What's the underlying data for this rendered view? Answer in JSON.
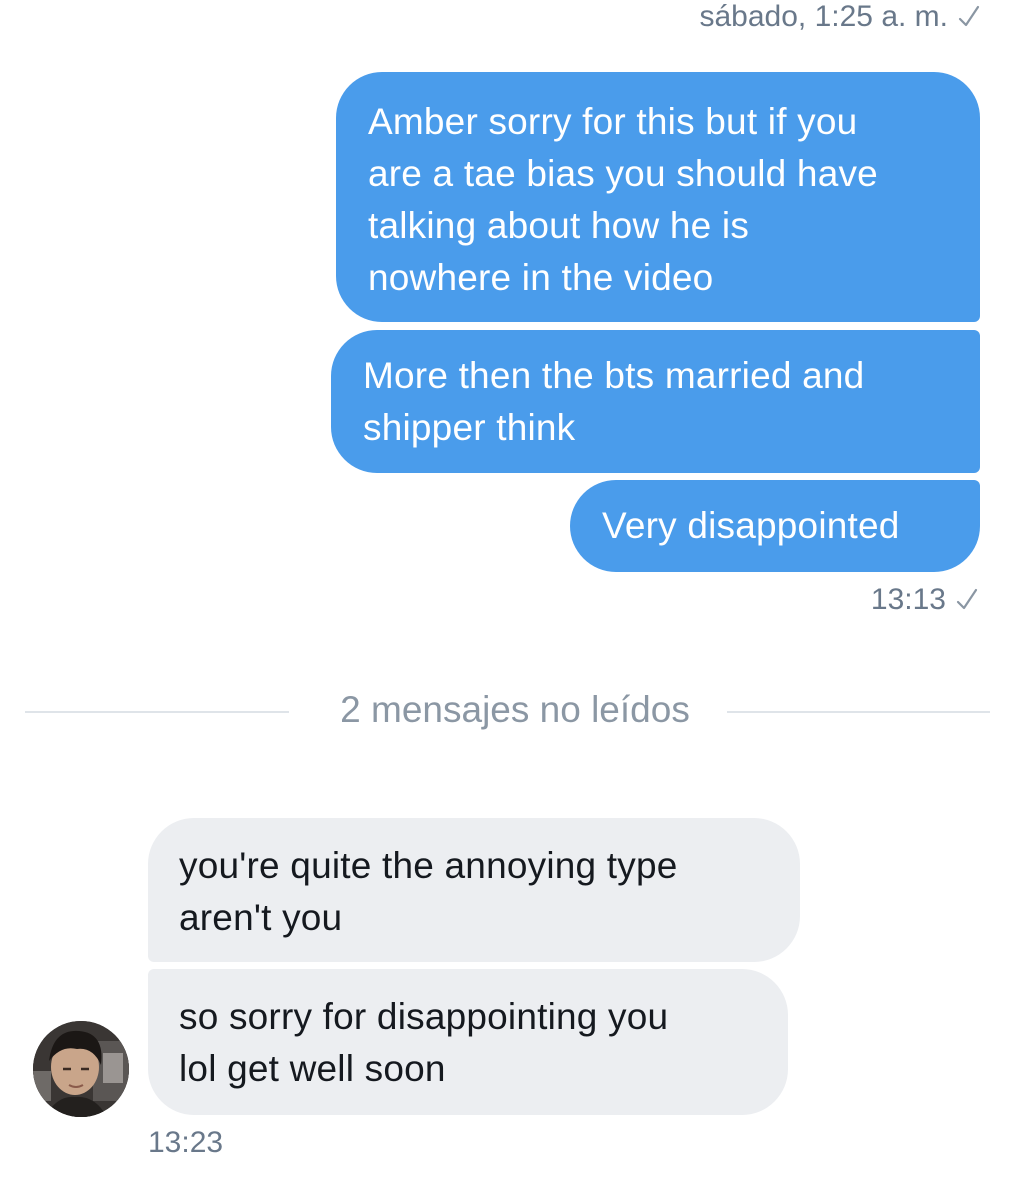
{
  "conversation": {
    "header_timestamp": "sábado, 1:25 a. m.",
    "outgoing": [
      {
        "text": "Amber sorry for this but if you\nare a tae bias you should have\ntalking about how he is\nnowhere in the video"
      },
      {
        "text": "More then the bts married and\nshipper think"
      },
      {
        "text": "Very disappointed"
      }
    ],
    "outgoing_time": "13:13",
    "unread_divider": "2 mensajes no leídos",
    "incoming": [
      {
        "text": "you're quite the annoying type\naren't you"
      },
      {
        "text": "so sorry for disappointing you\nlol get well soon"
      }
    ],
    "incoming_time": "13:23"
  },
  "icons": {
    "read_receipt": "checkmark-icon",
    "sender_avatar": "user-avatar"
  },
  "colors": {
    "outgoing_bubble": "#4a9ceb",
    "incoming_bubble": "#eceef1",
    "timestamp_text": "#69788a",
    "divider_text": "#8b97a4"
  }
}
